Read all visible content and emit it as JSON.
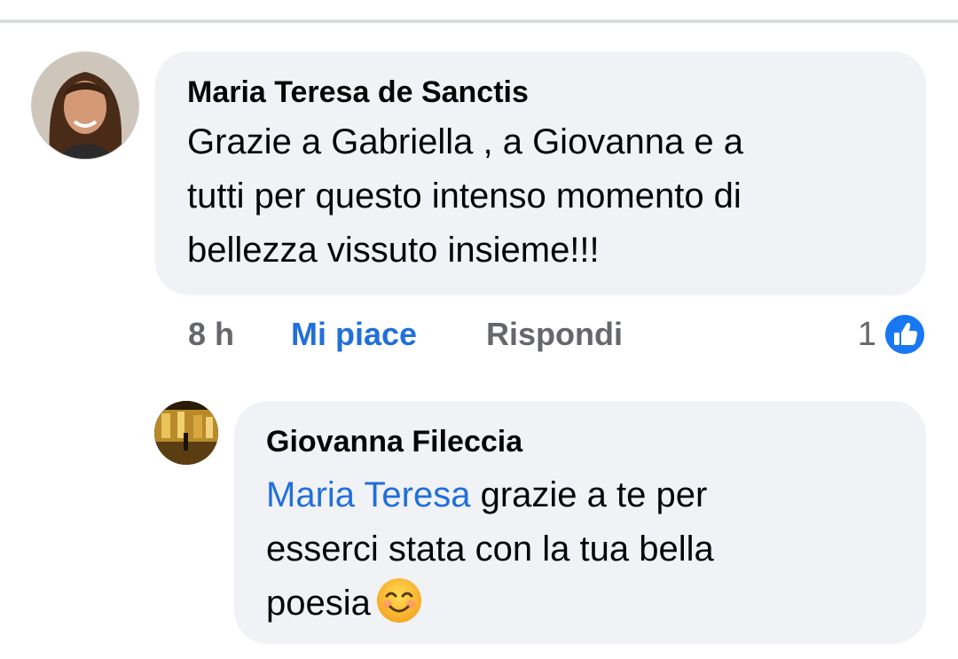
{
  "comments": [
    {
      "author": "Maria Teresa de Sanctis",
      "text": "Grazie a Gabriella , a Giovanna e a\ntutti  per questo intenso momento di\nbellezza vissuto insieme!!!",
      "time": "8 h",
      "like_label": "Mi piace",
      "reply_label": "Rispondi",
      "reaction_count": "1",
      "reaction_icon": "like-thumbs-up-icon"
    },
    {
      "author": "Giovanna Fileccia",
      "mention": "Maria Teresa",
      "text_after_mention": " grazie a te per\nesserci stata con la tua bella\npoesia",
      "emoji": "smiling-face-icon"
    }
  ],
  "colors": {
    "bubble_bg": "#f0f2f5",
    "link_blue": "#216fdb",
    "meta_gray": "#65676b",
    "text_dark": "#050505",
    "like_badge_blue": "#1877f2"
  }
}
